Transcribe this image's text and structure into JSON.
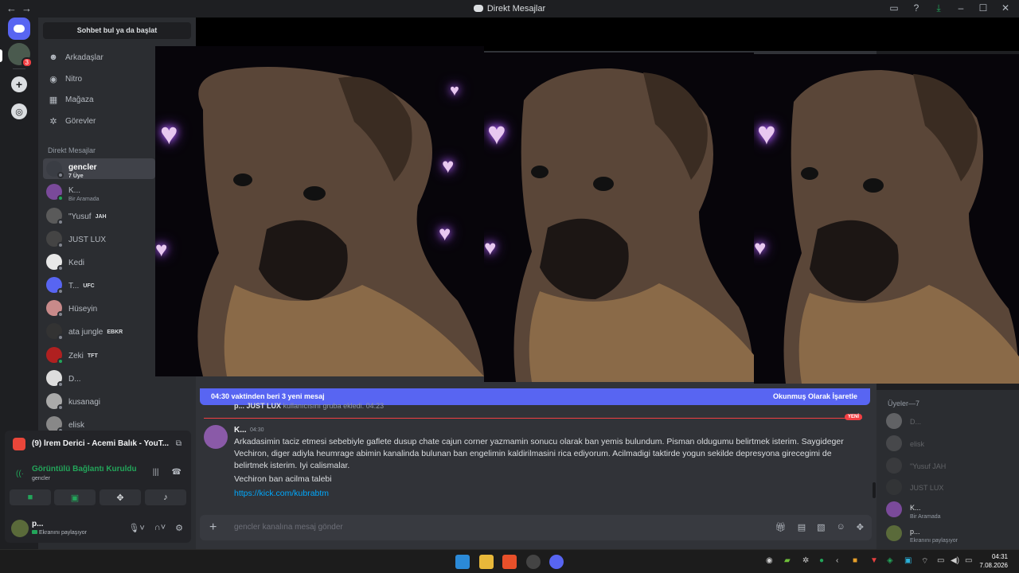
{
  "window": {
    "title": "Direkt Mesajlar",
    "back": "←",
    "forward": "→"
  },
  "servers": {
    "badge": "3"
  },
  "sidebar": {
    "search_label": "Sohbet bul ya da başlat",
    "nav": [
      {
        "label": "Arkadaşlar"
      },
      {
        "label": "Nitro"
      },
      {
        "label": "Mağaza"
      },
      {
        "label": "Görevler"
      }
    ],
    "dm_header": "Direkt Mesajlar",
    "dms": [
      {
        "name": "gencler",
        "sub": "7 Üye",
        "tag": "",
        "color": "#3a3d44"
      },
      {
        "name": "K...",
        "sub": "Bir Aramada",
        "tag": "",
        "color": "#7a4a9a"
      },
      {
        "name": "\"Yusuf",
        "sub": "",
        "tag": "JAH",
        "color": "#5a5a5a"
      },
      {
        "name": "JUST LUX",
        "sub": "",
        "tag": "",
        "color": "#444"
      },
      {
        "name": "Kedi",
        "sub": "",
        "tag": "",
        "color": "#e8e8e8"
      },
      {
        "name": "T...",
        "sub": "",
        "tag": "UFC",
        "color": "#5865f2"
      },
      {
        "name": "Hüseyin",
        "sub": "",
        "tag": "",
        "color": "#c88a8a"
      },
      {
        "name": "ata jungle",
        "sub": "",
        "tag": "EBKR",
        "color": "#333"
      },
      {
        "name": "Zeki",
        "sub": "",
        "tag": "TFT",
        "color": "#b02020"
      },
      {
        "name": "D...",
        "sub": "",
        "tag": "",
        "color": "#ddd"
      },
      {
        "name": "kusanagi",
        "sub": "",
        "tag": "",
        "color": "#aaa"
      },
      {
        "name": "elisk",
        "sub": "",
        "tag": "",
        "color": "#888"
      }
    ]
  },
  "media": {
    "title": "(9) İrem Derici - Acemi Balık - YouT..."
  },
  "voice": {
    "status": "Görüntülü Bağlantı Kuruldu",
    "channel": "gencler"
  },
  "user": {
    "name": "p...",
    "status": "Ekranını paylaşıyor"
  },
  "chat": {
    "new_bar_left": "04:30 vaktinden beri 3 yeni mesaj",
    "new_bar_right": "Okunmuş Olarak İşaretle",
    "system_author": "p... JUST LUX",
    "system_text": "kullanıcısını gruba ekledi.",
    "system_time": "04:23",
    "new_label": "YENİ",
    "message": {
      "author": "K...",
      "time": "04:30",
      "text": "Arkadasimin taciz etmesi sebebiyle gaflete dusup chate cajun corner yazmamin sonucu olarak ban yemis bulundum. Pisman oldugumu belirtmek isterim. Saygideger Vechiron, diger adiyla heumrage abimin kanalinda bulunan ban engelimin kaldirilmasini rica ediyorum. Acilmadigi taktirde yogun sekilde depresyona girecegimi de belirtmek isterim. Iyi calismalar.",
      "text2": "Vechiron ban acilma talebi",
      "link": "https://kick.com/kubrabtm"
    },
    "composer_placeholder": "gencler kanalına mesaj gönder"
  },
  "members": {
    "header": "Üyeler—7",
    "list": [
      {
        "name": "D...",
        "sub": "",
        "off": true,
        "color": "#ddd"
      },
      {
        "name": "elisk",
        "sub": "",
        "off": true,
        "color": "#888"
      },
      {
        "name": "\"Yusuf  JAH",
        "sub": "",
        "off": true,
        "color": "#5a5a5a"
      },
      {
        "name": "JUST LUX",
        "sub": "",
        "off": true,
        "color": "#444"
      },
      {
        "name": "K...",
        "sub": "Bir Aramada",
        "off": false,
        "color": "#7a4a9a"
      },
      {
        "name": "p...",
        "sub": "Ekranını paylaşıyor",
        "off": false,
        "color": "#5a6a3a"
      }
    ]
  },
  "taskbar": {
    "time": "04:31",
    "date": "7.08.2026"
  }
}
